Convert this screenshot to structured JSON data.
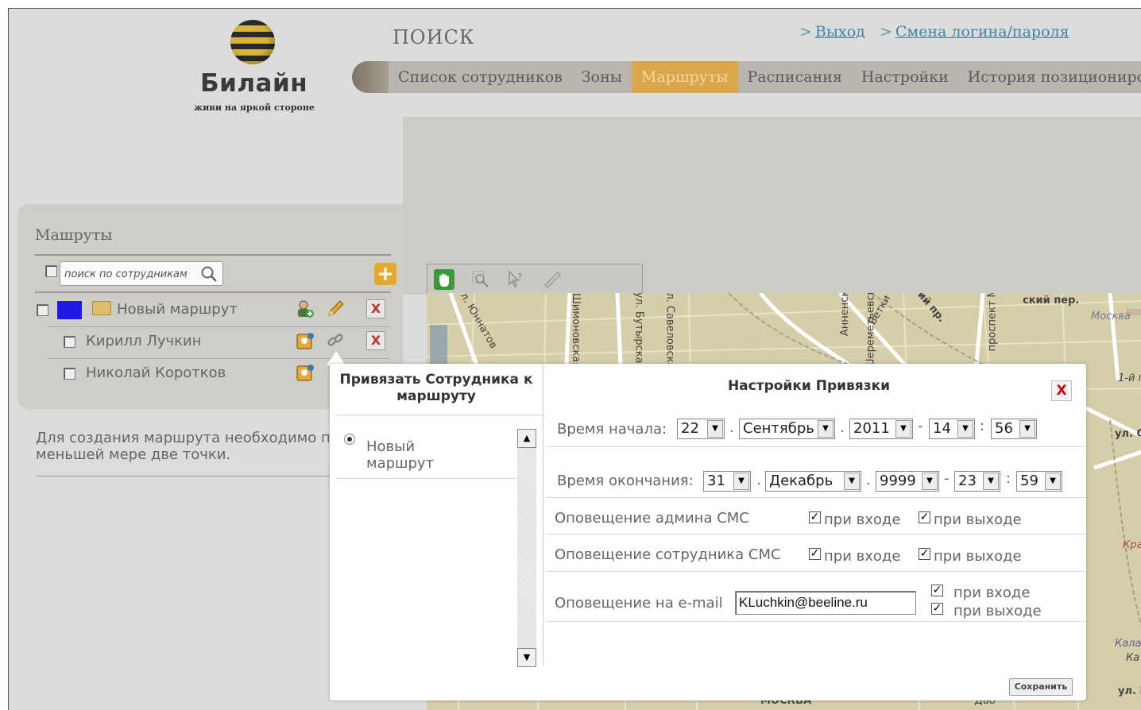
{
  "header": {
    "logo_name": "Билайн",
    "logo_slogan": "живи на яркой стороне",
    "page_title": "ПОИСК",
    "links": [
      {
        "label": "Выход"
      },
      {
        "label": "Смена логина/пароля"
      }
    ]
  },
  "nav": {
    "items": [
      {
        "label": "Список сотрудников",
        "active": false
      },
      {
        "label": "Зоны",
        "active": false
      },
      {
        "label": "Маршруты",
        "active": true
      },
      {
        "label": "Расписания",
        "active": false
      },
      {
        "label": "Настройки",
        "active": false
      },
      {
        "label": "История позиционирования",
        "active": false
      }
    ]
  },
  "routes_panel": {
    "title": "Машруты",
    "search_placeholder": "поиск по сотрудникам",
    "route_name": "Новый маршрут",
    "route_color": "#1d1ae8",
    "employees": [
      "Кирилл Лучкин",
      "Николай Коротков"
    ],
    "hint": "Для создания маршрута необходимо по меньшей мере две точки."
  },
  "map": {
    "labels": [
      "ул. Юннатов",
      "Шимоновская",
      "ул. Бутырская",
      "ул. Савеловская",
      "Анненская",
      "Шереметьевская",
      "Ветки",
      "проспект Мира",
      "Москва",
      "ул. С",
      "1-й п",
      "Красн",
      "Калан",
      "Ка",
      "ул. К",
      "МОСКВА",
      "Дао",
      "ский пер.",
      "ий пр."
    ]
  },
  "dialog": {
    "left_title": "Привязать Сотрудника к маршруту",
    "route_option": "Новый маршрут",
    "right_title": "Настройки Привязки",
    "close_label": "X",
    "start": {
      "label": "Время начала:",
      "day": "22",
      "month": "Сентябрь",
      "year": "2011",
      "hour": "14",
      "minute": "56"
    },
    "end": {
      "label": "Время окончания:",
      "day": "31",
      "month": "Декабрь",
      "year": "9999",
      "hour": "23",
      "minute": "59"
    },
    "admin_sms": {
      "label": "Оповещение админа СМС",
      "on_enter": "при входе",
      "on_exit": "при выходе"
    },
    "employee_sms": {
      "label": "Оповещение сотрудника СМС",
      "on_enter": "при входе",
      "on_exit": "при выходе"
    },
    "email": {
      "label": "Оповещение на e-mail",
      "value": "KLuchkin@beeline.ru",
      "on_enter": "при входе",
      "on_exit": "при выходе"
    },
    "save_label": "Сохранить"
  }
}
